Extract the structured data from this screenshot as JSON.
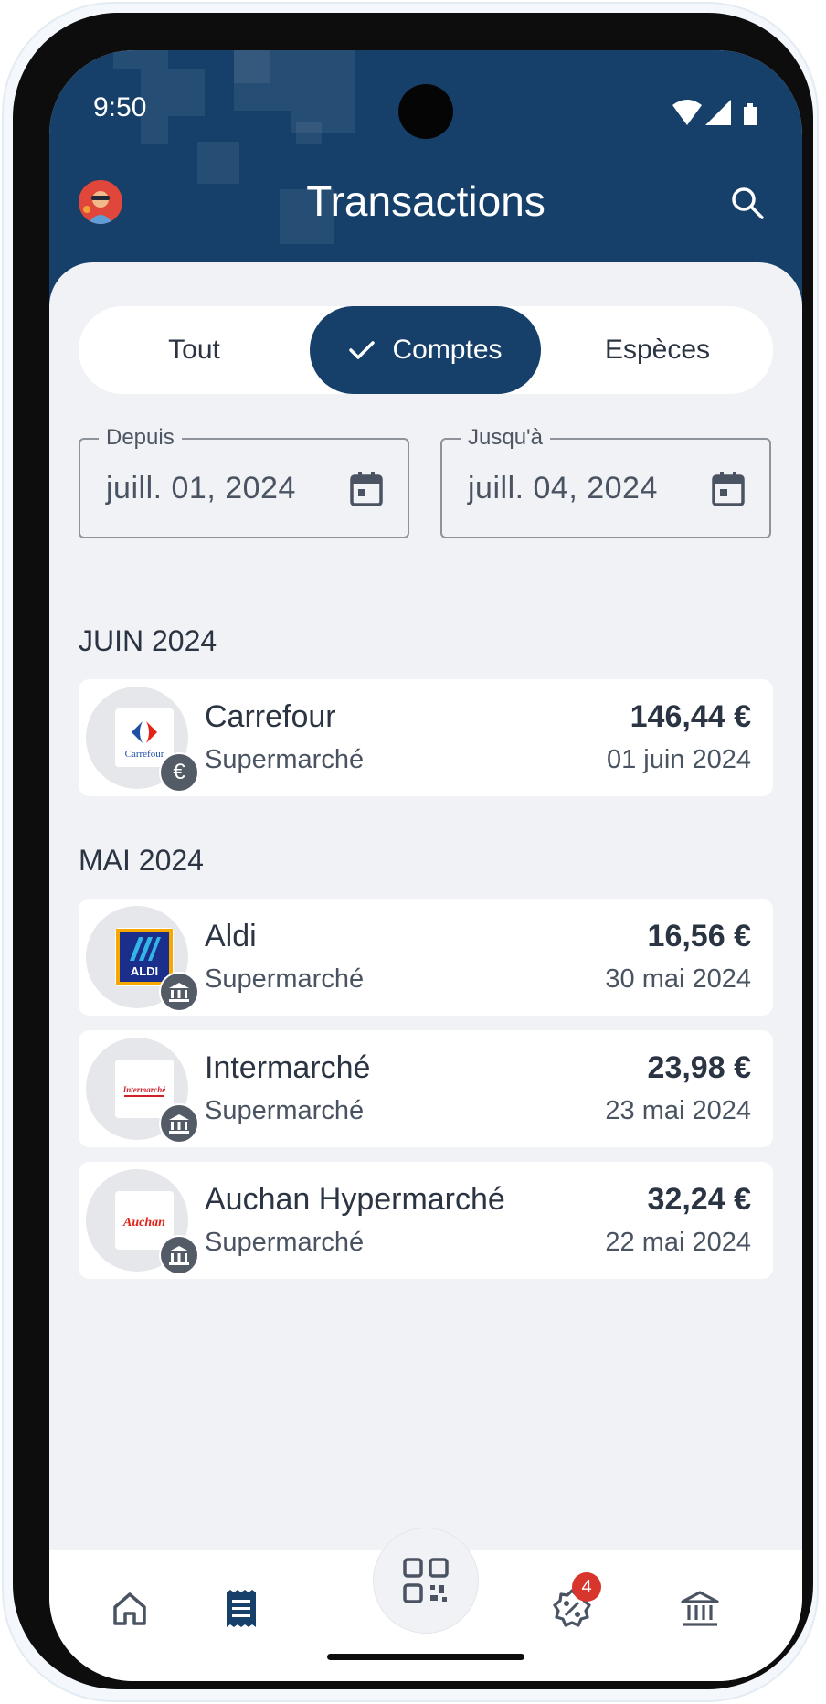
{
  "status_bar": {
    "time": "9:50"
  },
  "header": {
    "title": "Transactions"
  },
  "filter_tabs": [
    {
      "label": "Tout",
      "active": false
    },
    {
      "label": "Comptes",
      "active": true
    },
    {
      "label": "Espèces",
      "active": false
    }
  ],
  "date_range": {
    "from_label": "Depuis",
    "from_value": "juill. 01, 2024",
    "to_label": "Jusqu'à",
    "to_value": "juill. 04, 2024"
  },
  "groups": [
    {
      "month": "JUIN 2024",
      "transactions": [
        {
          "merchant": "Carrefour",
          "category": "Supermarché",
          "amount": "146,44 €",
          "date": "01 juin 2024",
          "logo_text": "Carrefour",
          "badge": "€",
          "badge_icon": "euro-icon"
        }
      ]
    },
    {
      "month": "MAI 2024",
      "transactions": [
        {
          "merchant": "Aldi",
          "category": "Supermarché",
          "amount": "16,56 €",
          "date": "30 mai 2024",
          "logo_text": "ALDI",
          "badge_icon": "bank-icon"
        },
        {
          "merchant": "Intermarché",
          "category": "Supermarché",
          "amount": "23,98 €",
          "date": "23 mai 2024",
          "logo_text": "Intermarché",
          "badge_icon": "bank-icon"
        },
        {
          "merchant": "Auchan Hypermarché",
          "category": "Supermarché",
          "amount": "32,24 €",
          "date": "22 mai 2024",
          "logo_text": "Auchan",
          "badge_icon": "bank-icon"
        }
      ]
    }
  ],
  "bottom_nav": {
    "items": [
      "home-icon",
      "receipt-icon",
      "qr-code-icon",
      "discount-icon",
      "bank-icon"
    ],
    "active": "receipt-icon",
    "offers_badge": "4"
  },
  "colors": {
    "primary": "#16406a",
    "background": "#f1f2f6",
    "text": "#2b3442",
    "badge_red": "#d8362c"
  }
}
